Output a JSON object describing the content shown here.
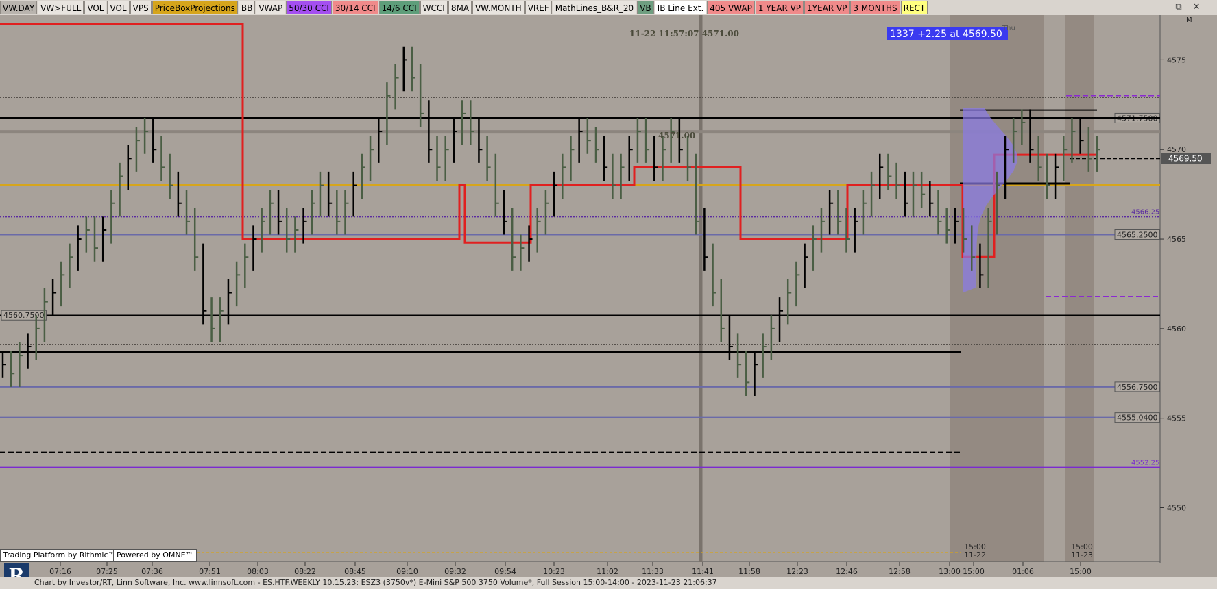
{
  "toolbar": {
    "items": [
      {
        "label": "VW.DAY",
        "bg": "#b9b4ae"
      },
      {
        "label": "VW>FULL",
        "bg": "#e8e4df"
      },
      {
        "label": "VOL",
        "bg": "#e8e4df"
      },
      {
        "label": "VOL",
        "bg": "#e8e4df"
      },
      {
        "label": "VPS",
        "bg": "#e8e4df"
      },
      {
        "label": "PriceBoxProjections",
        "bg": "#d6a51c"
      },
      {
        "label": "BB",
        "bg": "#e8e4df"
      },
      {
        "label": "VWAP",
        "bg": "#e8e4df"
      },
      {
        "label": "50/30 CCI",
        "bg": "#a44ff0"
      },
      {
        "label": "30/14 CCI",
        "bg": "#f08a8a"
      },
      {
        "label": "14/6 CCI",
        "bg": "#5e9e7a"
      },
      {
        "label": "WCCI",
        "bg": "#e8e4df"
      },
      {
        "label": "8MA",
        "bg": "#e8e4df"
      },
      {
        "label": "VW.MONTH",
        "bg": "#e8e4df"
      },
      {
        "label": "VREF",
        "bg": "#e8e4df"
      },
      {
        "label": "MathLines_B&R_20",
        "bg": "#e8e4df"
      },
      {
        "label": "VB",
        "bg": "#6e9e80"
      },
      {
        "label": "IB Line Ext.",
        "bg": "#ffffff"
      },
      {
        "label": "405 VWAP",
        "bg": "#f08a8a"
      },
      {
        "label": "1 YEAR VP",
        "bg": "#f08a8a"
      },
      {
        "label": "1YEAR VP",
        "bg": "#f08a8a"
      },
      {
        "label": "3 MONTHS",
        "bg": "#f08a8a"
      },
      {
        "label": "RECT",
        "bg": "#ffff80"
      }
    ],
    "window_icons": [
      "restore-icon",
      "close-icon"
    ]
  },
  "chart_data": {
    "type": "bar",
    "instrument": "ESZ3 (3750v*)",
    "ylim": [
      4547,
      4577.5
    ],
    "y_ticks": [
      "4575",
      "4570",
      "4565",
      "4560",
      "4555",
      "4550"
    ],
    "x_ticks": [
      "07:16",
      "07:25",
      "07:36",
      "07:51",
      "08:03",
      "08:22",
      "08:45",
      "09:10",
      "09:32",
      "09:54",
      "10:23",
      "11:02",
      "11:33",
      "11:41",
      "11:58",
      "12:23",
      "12:46",
      "12:58",
      "13:00",
      "15:00",
      "01:06",
      "15:00"
    ],
    "session_labels": [
      {
        "time": "15:00",
        "date": "11-22"
      },
      {
        "time": "15:00",
        "date": "11-23"
      }
    ],
    "cursor_readout": "11-22 11:57:07  4571.00",
    "cursor_price_label": "4571.00",
    "last_trade_box": "1337  +2.25 at 4569.50",
    "current_price": "4569.50",
    "day_label": "Thu",
    "levels": [
      {
        "price": 4571.75,
        "label": "4571.7500",
        "color": "#000000",
        "style": "solid"
      },
      {
        "price": 4566.25,
        "label": "4566.25",
        "color": "#5a2aa0",
        "style": "dotted"
      },
      {
        "price": 4565.25,
        "label": "4565.2500",
        "color": "#6a6aa8",
        "style": "solid"
      },
      {
        "price": 4560.75,
        "label": "4560.7500",
        "color": "#000000",
        "style": "solid"
      },
      {
        "price": 4556.75,
        "label": "4556.7500",
        "color": "#6a6aa8",
        "style": "solid"
      },
      {
        "price": 4555.04,
        "label": "4555.0400",
        "color": "#6a6aa8",
        "style": "solid"
      },
      {
        "price": 4552.25,
        "label": "4552.25",
        "color": "#7a2ad0",
        "style": "solid"
      }
    ],
    "bars": [
      4558,
      4557.5,
      4558.5,
      4559,
      4560,
      4561.5,
      4562,
      4563,
      4564,
      4565,
      4565.5,
      4564.5,
      4565.5,
      4567,
      4568.5,
      4569.5,
      4570.5,
      4571,
      4570,
      4569,
      4568,
      4567,
      4566,
      4564,
      4561,
      4560,
      4561,
      4562,
      4563,
      4564,
      4565,
      4566,
      4567,
      4566,
      4565,
      4565.5,
      4566,
      4567,
      4568,
      4567,
      4566,
      4567,
      4568,
      4569,
      4570,
      4571,
      4573,
      4574,
      4575,
      4574,
      4572,
      4570,
      4569,
      4570,
      4571,
      4572,
      4571,
      4570,
      4569,
      4567,
      4566,
      4564,
      4564.5,
      4565,
      4566,
      4567,
      4568,
      4569,
      4570,
      4571,
      4570.5,
      4570,
      4569,
      4568,
      4569,
      4570,
      4571,
      4570,
      4569,
      4570,
      4571,
      4570,
      4569,
      4566,
      4564,
      4562,
      4560,
      4559,
      4558,
      4557,
      4558,
      4559,
      4560,
      4561,
      4562,
      4563,
      4564,
      4565,
      4566,
      4567,
      4566,
      4565,
      4566,
      4567,
      4568,
      4569,
      4568.5,
      4568,
      4567,
      4568,
      4567.5,
      4567,
      4566,
      4565.5,
      4566,
      4565,
      4564,
      4563,
      4566,
      4568,
      4570,
      4571,
      4571.5,
      4570,
      4569,
      4568,
      4569,
      4570,
      4571,
      4570.5,
      4569.5,
      4570
    ]
  },
  "footer": {
    "text": "Chart by Investor/RT, Linn Software, Inc. www.linnsoft.com - ES.HTF.WEEKLY    10.15.23: ESZ3 (3750v*) E-Mini S&P 500 3750 Volume*, Full Session 15:00-14:00 - 2023-11-23 21:06:37",
    "rithmic": "Trading Platform by Rithmic™",
    "omne": "Powered by OMNE™"
  }
}
